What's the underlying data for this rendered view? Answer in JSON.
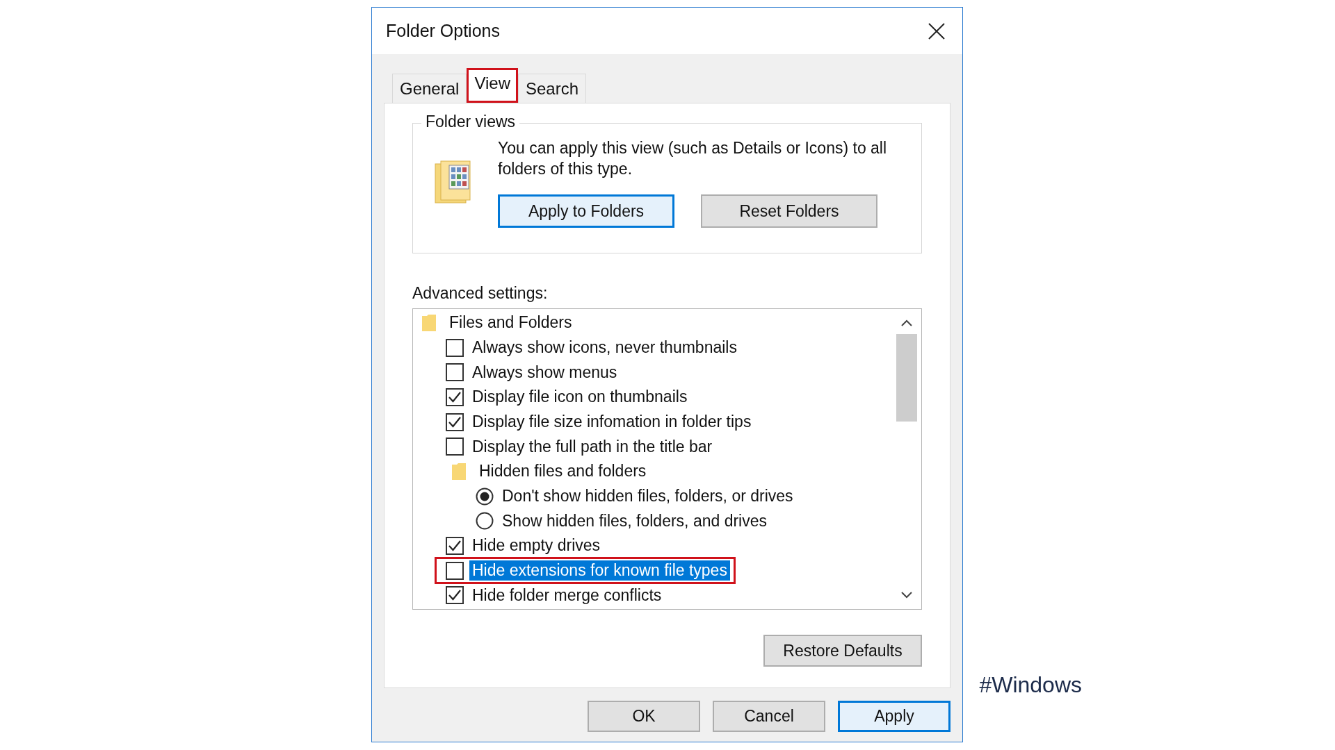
{
  "window": {
    "title": "Folder Options"
  },
  "tabs": [
    {
      "label": "General",
      "selected": false,
      "annotated": false
    },
    {
      "label": "View",
      "selected": true,
      "annotated": true
    },
    {
      "label": "Search",
      "selected": false,
      "annotated": false
    }
  ],
  "folder_views": {
    "title": "Folder views",
    "description": "You can apply this view (such as Details or Icons) to all folders of this type.",
    "buttons": [
      {
        "label": "Apply to Folders",
        "focused": true
      },
      {
        "label": "Reset Folders",
        "focused": false
      }
    ]
  },
  "advanced": {
    "label": "Advanced settings:",
    "items": [
      {
        "kind": "group",
        "label": "Files and Folders",
        "children": [
          {
            "kind": "checkbox",
            "label": "Always show icons, never thumbnails",
            "checked": false,
            "selected": false,
            "annotated": false
          },
          {
            "kind": "checkbox",
            "label": "Always show menus",
            "checked": false,
            "selected": false,
            "annotated": false
          },
          {
            "kind": "checkbox",
            "label": "Display file icon on thumbnails",
            "checked": true,
            "selected": false,
            "annotated": false
          },
          {
            "kind": "checkbox",
            "label": "Display file size infomation in folder tips",
            "checked": true,
            "selected": false,
            "annotated": false
          },
          {
            "kind": "checkbox",
            "label": "Display the full path in the title bar",
            "checked": false,
            "selected": false,
            "annotated": false
          },
          {
            "kind": "group",
            "label": "Hidden files and folders",
            "children": [
              {
                "kind": "radio",
                "label": "Don't show hidden files, folders, or drives",
                "checked": true,
                "selected": false,
                "annotated": false
              },
              {
                "kind": "radio",
                "label": "Show hidden files, folders, and drives",
                "checked": false,
                "selected": false,
                "annotated": false
              }
            ]
          },
          {
            "kind": "checkbox",
            "label": "Hide empty drives",
            "checked": true,
            "selected": false,
            "annotated": false
          },
          {
            "kind": "checkbox",
            "label": "Hide extensions for known file types",
            "checked": false,
            "selected": true,
            "annotated": true
          },
          {
            "kind": "checkbox",
            "label": "Hide folder merge conflicts",
            "checked": true,
            "selected": false,
            "annotated": false
          }
        ]
      }
    ]
  },
  "restore_button": "Restore Defaults",
  "footer_buttons": [
    {
      "label": "OK",
      "focused": false
    },
    {
      "label": "Cancel",
      "focused": false
    },
    {
      "label": "Apply",
      "focused": true
    }
  ],
  "tag": "#Windows"
}
